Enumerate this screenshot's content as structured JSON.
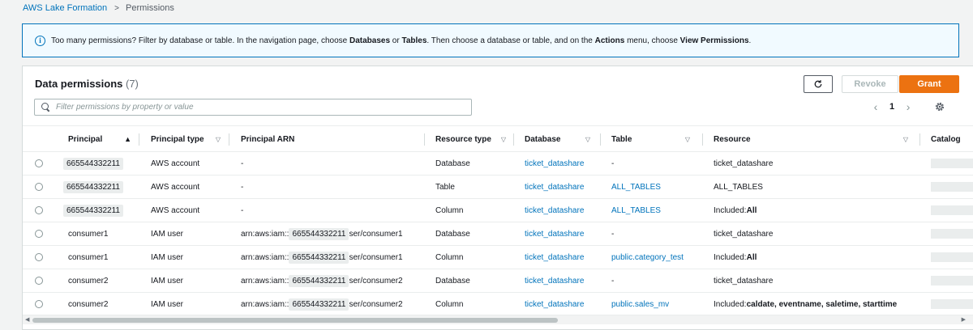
{
  "breadcrumb": {
    "parent": "AWS Lake Formation",
    "current": "Permissions"
  },
  "info_banner": {
    "icon": "info-icon",
    "parts": [
      {
        "text": "Too many permissions? Filter by database or table. In the navigation page, choose ",
        "bold": false
      },
      {
        "text": "Databases",
        "bold": true
      },
      {
        "text": " or ",
        "bold": false
      },
      {
        "text": "Tables",
        "bold": true
      },
      {
        "text": ". Then choose a database or table, and on the ",
        "bold": false
      },
      {
        "text": "Actions",
        "bold": true
      },
      {
        "text": " menu, choose ",
        "bold": false
      },
      {
        "text": "View Permissions",
        "bold": true
      },
      {
        "text": ".",
        "bold": false
      }
    ]
  },
  "panel": {
    "title": "Data permissions",
    "count": "(7)",
    "search_placeholder": "Filter permissions by property or value",
    "buttons": {
      "revoke": "Revoke",
      "grant": "Grant"
    },
    "pager": {
      "page": "1"
    }
  },
  "columns": [
    {
      "key": "principal",
      "label": "Principal",
      "sort": "▲"
    },
    {
      "key": "principal_type",
      "label": "Principal type",
      "sort": "▽"
    },
    {
      "key": "principal_arn",
      "label": "Principal ARN",
      "sort": ""
    },
    {
      "key": "resource_type",
      "label": "Resource type",
      "sort": "▽"
    },
    {
      "key": "database",
      "label": "Database",
      "sort": "▽"
    },
    {
      "key": "table",
      "label": "Table",
      "sort": "▽"
    },
    {
      "key": "resource",
      "label": "Resource",
      "sort": "▽"
    },
    {
      "key": "catalog",
      "label": "Catalog",
      "sort": ""
    }
  ],
  "rows": [
    {
      "principal": "665544332211",
      "principal_pill": true,
      "principal_type": "AWS account",
      "arn_prefix": "-",
      "arn_account": "",
      "arn_suffix": "",
      "resource_type": "Database",
      "database": "ticket_datashare",
      "table": "-",
      "table_link": false,
      "resource_label": "",
      "resource_value": "ticket_datashare"
    },
    {
      "principal": "665544332211",
      "principal_pill": true,
      "principal_type": "AWS account",
      "arn_prefix": "-",
      "arn_account": "",
      "arn_suffix": "",
      "resource_type": "Table",
      "database": "ticket_datashare",
      "table": "ALL_TABLES",
      "table_link": true,
      "resource_label": "",
      "resource_value": "ALL_TABLES"
    },
    {
      "principal": "665544332211",
      "principal_pill": true,
      "principal_type": "AWS account",
      "arn_prefix": "-",
      "arn_account": "",
      "arn_suffix": "",
      "resource_type": "Column",
      "database": "ticket_datashare",
      "table": "ALL_TABLES",
      "table_link": true,
      "resource_label": "Included: ",
      "resource_value": "All"
    },
    {
      "principal": "consumer1",
      "principal_pill": false,
      "principal_type": "IAM user",
      "arn_prefix": "arn:aws:iam::",
      "arn_account": "665544332211",
      "arn_suffix": "ser/consumer1",
      "resource_type": "Database",
      "database": "ticket_datashare",
      "table": "-",
      "table_link": false,
      "resource_label": "",
      "resource_value": "ticket_datashare"
    },
    {
      "principal": "consumer1",
      "principal_pill": false,
      "principal_type": "IAM user",
      "arn_prefix": "arn:aws:iam::",
      "arn_account": "665544332211",
      "arn_suffix": "ser/consumer1",
      "resource_type": "Column",
      "database": "ticket_datashare",
      "table": "public.category_test",
      "table_link": true,
      "resource_label": "Included: ",
      "resource_value": "All"
    },
    {
      "principal": "consumer2",
      "principal_pill": false,
      "principal_type": "IAM user",
      "arn_prefix": "arn:aws:iam::",
      "arn_account": "665544332211",
      "arn_suffix": "ser/consumer2",
      "resource_type": "Database",
      "database": "ticket_datashare",
      "table": "-",
      "table_link": false,
      "resource_label": "",
      "resource_value": "ticket_datashare"
    },
    {
      "principal": "consumer2",
      "principal_pill": false,
      "principal_type": "IAM user",
      "arn_prefix": "arn:aws:iam::",
      "arn_account": "665544332211",
      "arn_suffix": "ser/consumer2",
      "resource_type": "Column",
      "database": "ticket_datashare",
      "table": "public.sales_mv",
      "table_link": true,
      "resource_label": "Included: ",
      "resource_value": "caldate, eventname, saletime, starttime"
    }
  ],
  "colors": {
    "link": "#0073bb",
    "grant": "#ec7211",
    "banner_border": "#0073bb",
    "banner_bg": "#f1faff"
  }
}
